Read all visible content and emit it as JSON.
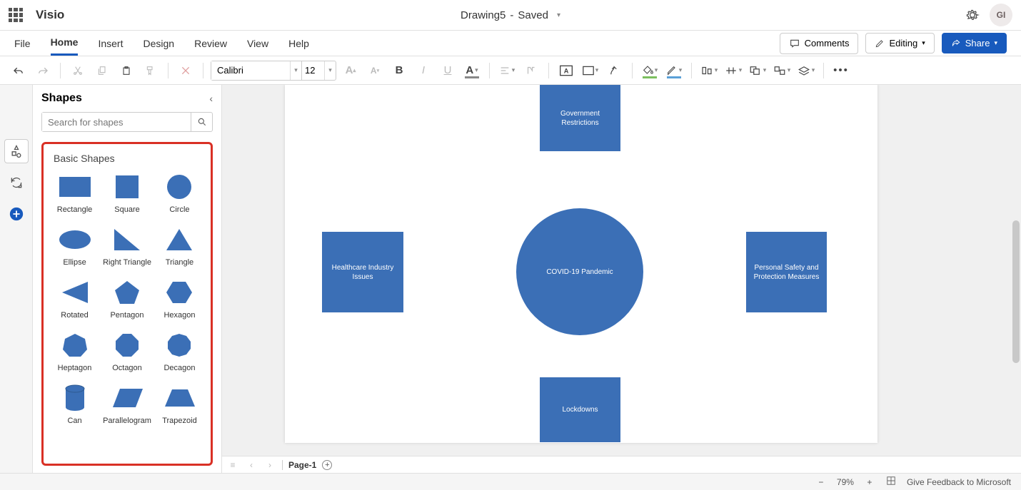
{
  "app": {
    "name": "Visio",
    "doc": "Drawing5",
    "saved_suffix": "Saved",
    "avatar": "GI"
  },
  "tabs": [
    "File",
    "Home",
    "Insert",
    "Design",
    "Review",
    "View",
    "Help"
  ],
  "active_tab": "Home",
  "ribbon_right": {
    "comments": "Comments",
    "editing": "Editing",
    "share": "Share"
  },
  "toolbar": {
    "font_name": "Calibri",
    "font_size": "12"
  },
  "shapes_panel": {
    "title": "Shapes",
    "search_placeholder": "Search for shapes",
    "group_title": "Basic Shapes",
    "items": [
      "Rectangle",
      "Square",
      "Circle",
      "Ellipse",
      "Right Triangle",
      "Triangle",
      "Rotated",
      "Pentagon",
      "Hexagon",
      "Heptagon",
      "Octagon",
      "Decagon",
      "Can",
      "Parallelogram",
      "Trapezoid"
    ]
  },
  "canvas_shapes": {
    "top": "Government Restrictions",
    "left": "Healthcare Industry Issues",
    "center": "COVID-19 Pandemic",
    "right": "Personal Safety and Protection Measures",
    "bottom": "Lockdowns"
  },
  "pagetabs": {
    "name": "Page-1"
  },
  "status": {
    "zoom": "79%",
    "feedback": "Give Feedback to Microsoft"
  }
}
